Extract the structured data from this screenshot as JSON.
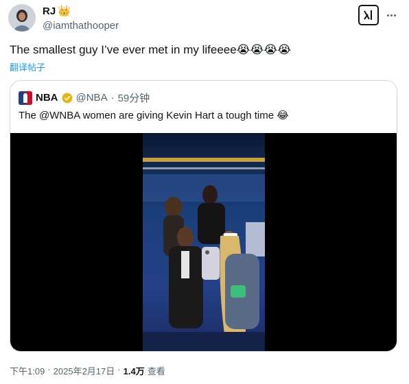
{
  "author": {
    "display_name": "RJ",
    "crown_emoji": "👑",
    "handle": "@iamthathooper"
  },
  "tweet": {
    "text": "The smallest guy I’ve ever met in my lifeeee😭😭😭😭",
    "translate_label": "翻译帖子"
  },
  "quoted_tweet": {
    "display_name": "NBA",
    "handle": "@NBA",
    "separator": "·",
    "time": "59分钟",
    "text": "The @WNBA women are giving Kevin Hart a tough time 😂"
  },
  "footer": {
    "time": "下午1:09",
    "separator": "·",
    "date": "2025年2月17日",
    "separator2": "·",
    "views": "1.4万",
    "views_label": "查看"
  },
  "icons": {
    "grok": "grok-icon",
    "more": "more-horizontal-icon",
    "verified": "verified-badge-icon",
    "nba_logo": "nba-logo"
  },
  "colors": {
    "link_blue": "#1d9bf0",
    "secondary_text": "#536471",
    "border": "#cfd9de",
    "verified_gold": "#e2b719"
  }
}
